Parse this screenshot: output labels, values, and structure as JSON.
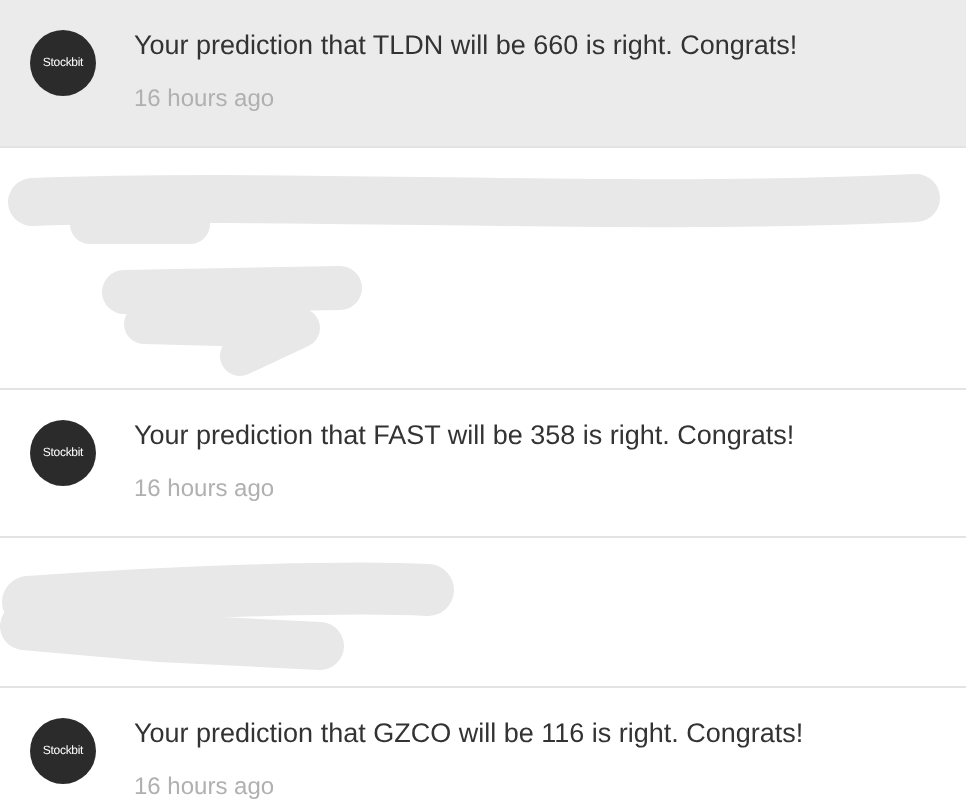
{
  "notifications": [
    {
      "kind": "notification",
      "unread": true,
      "avatar_text": "Stockbit",
      "message": "Your prediction that TLDN will be 660 is right. Congrats!",
      "time": "16 hours ago"
    },
    {
      "kind": "redacted"
    },
    {
      "kind": "notification",
      "unread": false,
      "avatar_text": "Stockbit",
      "message": "Your prediction that FAST will be 358 is right. Congrats!",
      "time": "16 hours ago"
    },
    {
      "kind": "redacted"
    },
    {
      "kind": "notification",
      "unread": false,
      "avatar_text": "Stockbit",
      "message": "Your prediction that GZCO will be 116 is right. Congrats!",
      "time": "16 hours ago"
    }
  ]
}
